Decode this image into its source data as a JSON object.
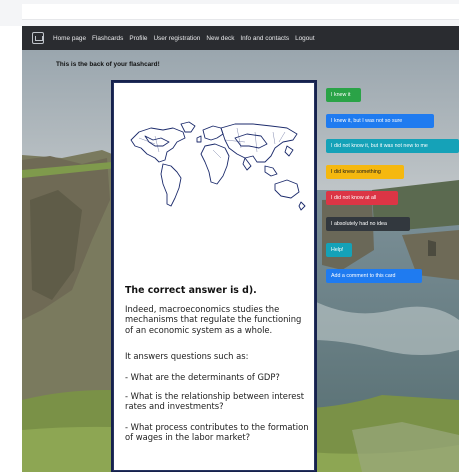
{
  "navbar": {
    "links": [
      "Home page",
      "Flashcards",
      "Profile",
      "User registration",
      "New deck",
      "Info and contacts",
      "Logout"
    ]
  },
  "page": {
    "heading": "This is the back of your flashcard!"
  },
  "card": {
    "answer_title": "The correct answer is d).",
    "paragraphs": [
      "Indeed, macroeconomics studies the mechanisms that regulate the functioning of an economic system as a whole.",
      "It answers questions such as:",
      "- What are the determinants of GDP?",
      "- What is the relationship between interest rates and investments?",
      "- What process contributes to the formation of wages in the labor market?"
    ]
  },
  "actions": [
    {
      "label": "I knew it",
      "color": "#2aa347"
    },
    {
      "label": "I knew it, but I was not so sure",
      "color": "#1f7bf0"
    },
    {
      "label": "I did not know it, but it was not new to me",
      "color": "#15a2b8"
    },
    {
      "label": "I did knew something",
      "color": "#f5b80f"
    },
    {
      "label": "I did not know at all",
      "color": "#dc3545"
    },
    {
      "label": "I absolutely had no idea",
      "color": "#32383e"
    },
    {
      "label": "Help!",
      "color": "#15a2b8"
    },
    {
      "label": "Add a comment to this card",
      "color": "#1f7bf0"
    }
  ]
}
